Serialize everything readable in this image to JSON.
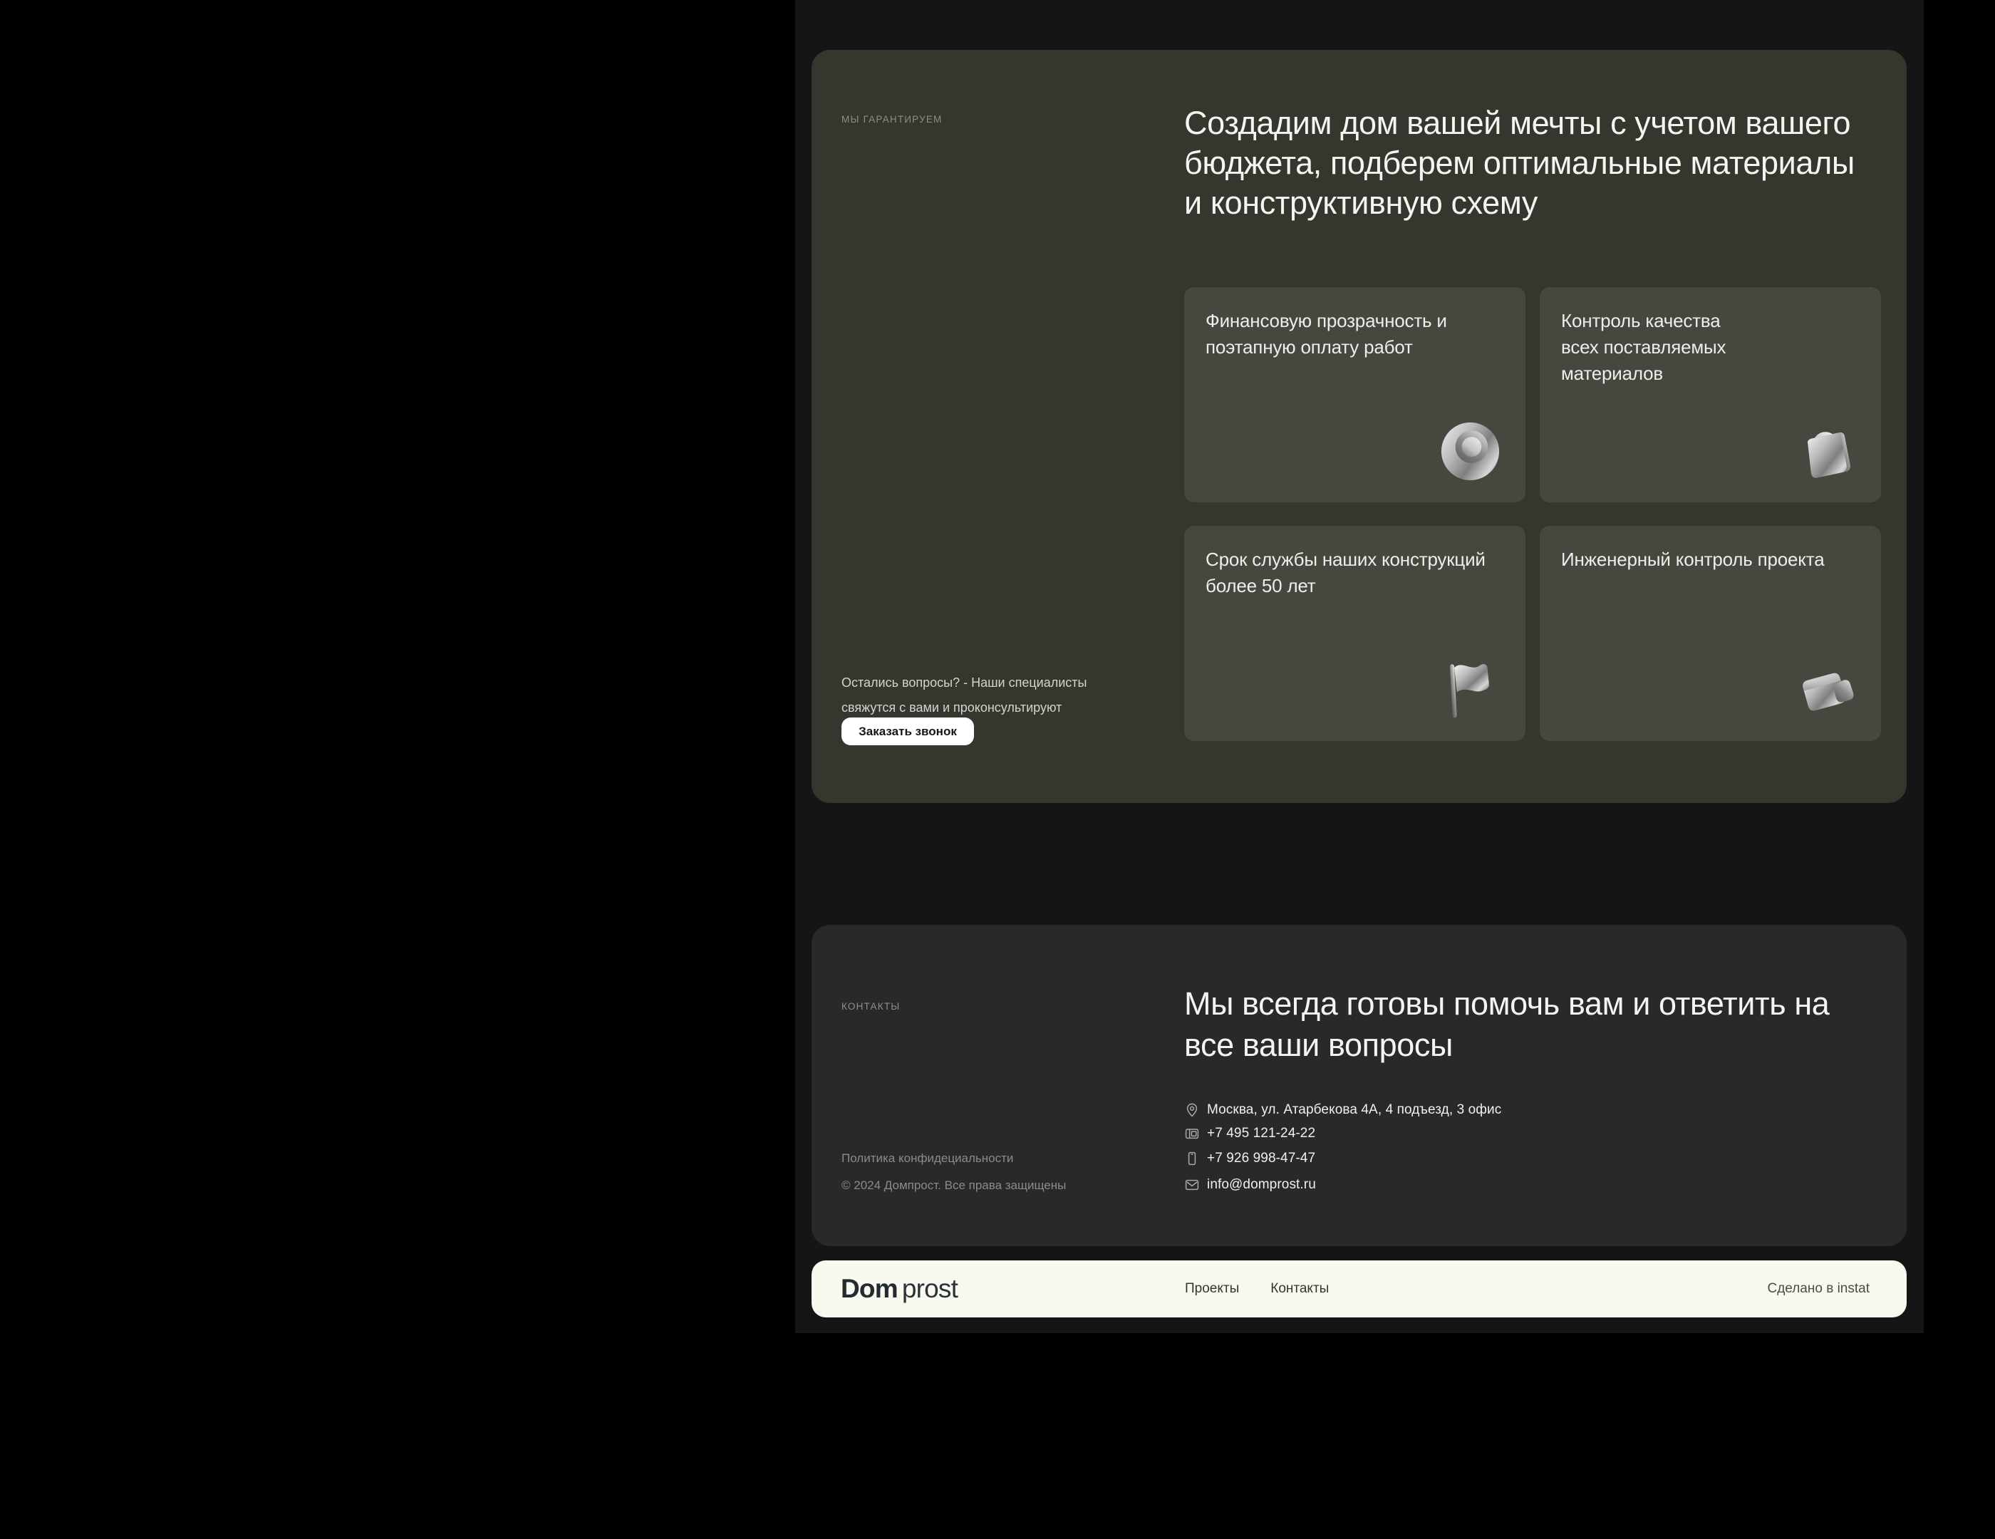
{
  "guarantee": {
    "label": "МЫ ГАРАНТИРУЕМ",
    "heading": "Создадим дом вашей мечты с учетом вашего\nбюджета, подберем оптимальные материалы\nи конструктивную схему",
    "cards": [
      {
        "icon": "coin-3d-icon",
        "text": "Финансовую прозрачность и\nпоэтапную оплату работ"
      },
      {
        "icon": "shopping-bag-3d-icon",
        "text": "Контроль качества\nвсех поставляемых\nматериалов"
      },
      {
        "icon": "flag-3d-icon",
        "text": "Срок службы наших конструкций\nболее 50 лет"
      },
      {
        "icon": "wallet-3d-icon",
        "text": "Инженерный контроль проекта"
      }
    ],
    "questions_text": "Остались вопросы? - Наши специалисты\nсвяжутся с вами и проконсультируют",
    "cta_label": "Заказать звонок"
  },
  "contacts": {
    "label": "КОНТАКТЫ",
    "heading": "Мы всегда готовы помочь вам и ответить на\nвсе ваши вопросы",
    "items": [
      {
        "icon": "location-pin-icon",
        "text": "Москва, ул. Атарбекова 4А, 4 подъезд, 3 офис"
      },
      {
        "icon": "desk-phone-icon",
        "text": "+7 495 121-24-22"
      },
      {
        "icon": "mobile-phone-icon",
        "text": "+7 926 998-47-47"
      },
      {
        "icon": "envelope-icon",
        "text": "info@domprost.ru"
      }
    ],
    "privacy_link": "Политика конфидециальности",
    "copyright": "© 2024 Домпрост. Все права защищены"
  },
  "footer": {
    "logo_bold": "Dom",
    "logo_light": "prost",
    "nav": [
      {
        "label": "Проекты"
      },
      {
        "label": "Контакты"
      }
    ],
    "made_by": "Сделано в instat"
  },
  "colors": {
    "outer_bg": "#000000",
    "viewport_bg": "#151516",
    "section_guarantee_bg": "#36362f",
    "card_bg": "#47473f",
    "section_contacts_bg": "#28292a",
    "footer_bg": "#f8faf0",
    "heading_text": "#f4f4f1",
    "muted_label": "#8f8f8a",
    "button_bg": "#ffffff",
    "button_text": "#161616"
  }
}
